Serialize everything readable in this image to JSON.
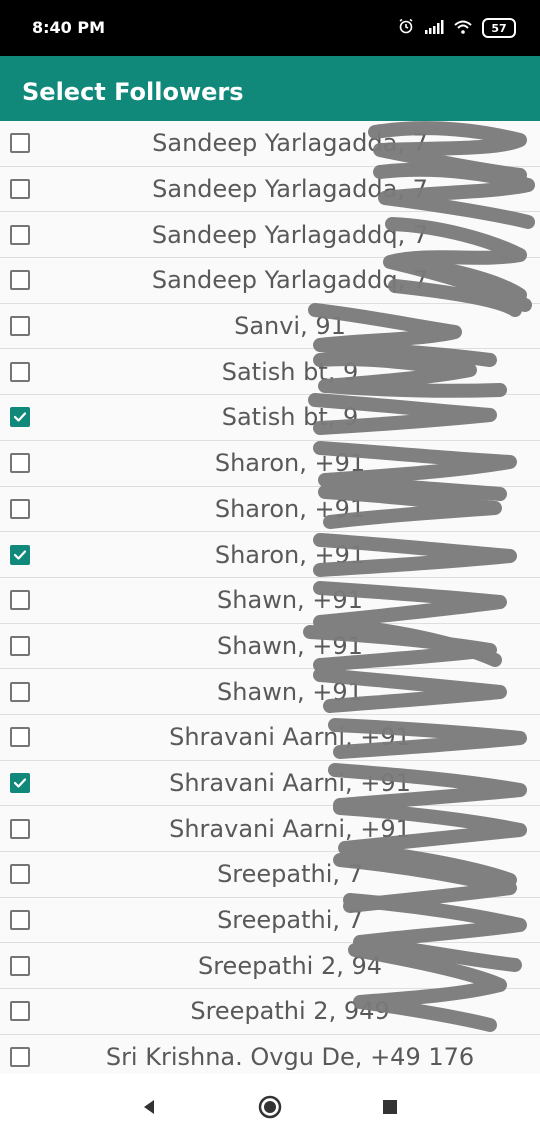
{
  "status": {
    "time": "8:40 PM",
    "battery": "57"
  },
  "app": {
    "title": "Select Followers"
  },
  "theme": {
    "accent": "#11897a",
    "status_bar_bg": "#000000",
    "row_text": "#595959",
    "scribble": "#7a7a7a"
  },
  "list": {
    "items": [
      {
        "label": "Sandeep Yarlagadda, 7",
        "checked": false
      },
      {
        "label": "Sandeep Yarlagadda, 7",
        "checked": false
      },
      {
        "label": "Sandeep Yarlagaddq, 7",
        "checked": false
      },
      {
        "label": "Sandeep Yarlagaddq, 7",
        "checked": false
      },
      {
        "label": "Sanvi, 91",
        "checked": false
      },
      {
        "label": "Satish bt, 9",
        "checked": false
      },
      {
        "label": "Satish bt, 9",
        "checked": true
      },
      {
        "label": "Sharon, +91",
        "checked": false
      },
      {
        "label": "Sharon, +91",
        "checked": false
      },
      {
        "label": "Sharon, +91",
        "checked": true
      },
      {
        "label": "Shawn, +91",
        "checked": false
      },
      {
        "label": "Shawn, +91",
        "checked": false
      },
      {
        "label": "Shawn, +91",
        "checked": false
      },
      {
        "label": "Shravani Aarni, +91",
        "checked": false
      },
      {
        "label": "Shravani Aarni, +91",
        "checked": true
      },
      {
        "label": "Shravani Aarni, +91",
        "checked": false
      },
      {
        "label": "Sreepathi, 7",
        "checked": false
      },
      {
        "label": "Sreepathi, 7",
        "checked": false
      },
      {
        "label": "Sreepathi 2, 94",
        "checked": false
      },
      {
        "label": "Sreepathi 2, 949",
        "checked": false
      },
      {
        "label": "Sri Krishna. Ovgu De, +49 176",
        "checked": false
      }
    ]
  },
  "nav": {
    "back_icon": "back-icon",
    "home_icon": "home-icon",
    "recents_icon": "recents-icon"
  }
}
